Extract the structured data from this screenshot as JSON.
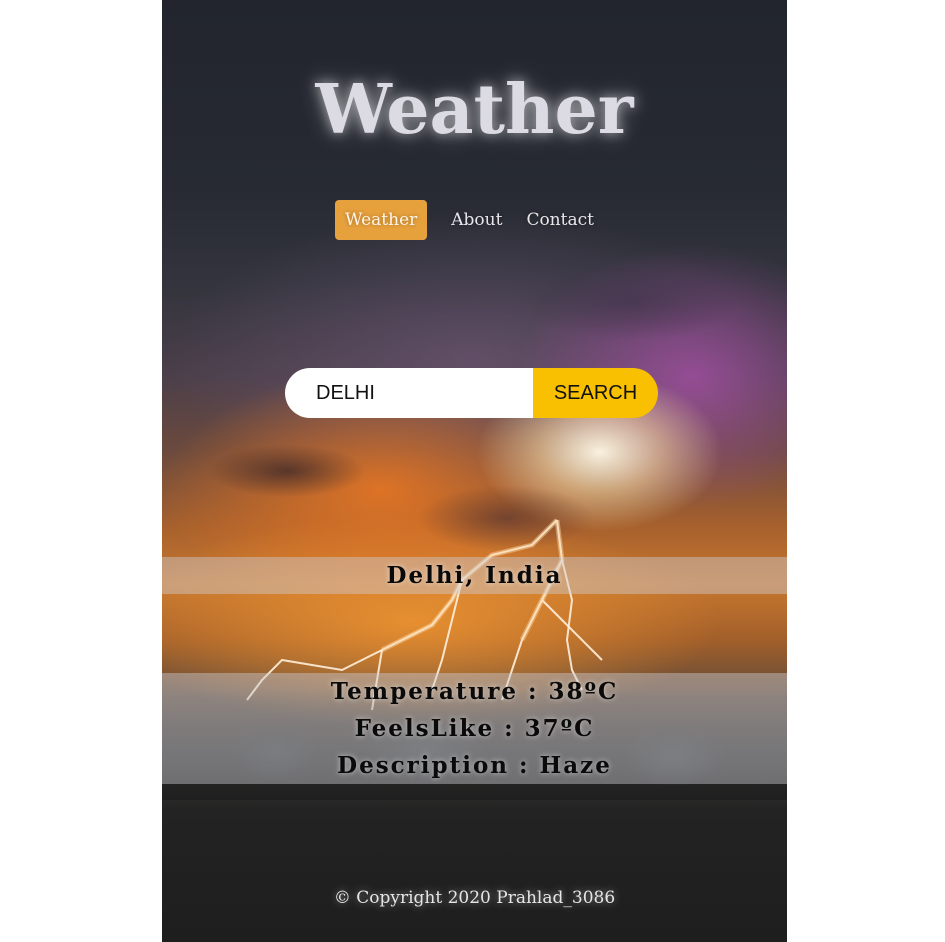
{
  "header": {
    "title": "Weather"
  },
  "nav": {
    "items": [
      {
        "label": "Weather",
        "active": true
      },
      {
        "label": "About",
        "active": false
      },
      {
        "label": "Contact",
        "active": false
      }
    ]
  },
  "search": {
    "value": "DELHI",
    "placeholder": "",
    "button_label": "SEARCH"
  },
  "result": {
    "city": "Delhi, India",
    "temperature": "Temperature : 38ºC",
    "feels_like": "FeelsLike : 37ºC",
    "description": "Description : Haze"
  },
  "footer": {
    "copyright": "© Copyright 2020 Prahlad_3086"
  },
  "colors": {
    "accent_nav": "#e6a03c",
    "search_button": "#f8c000",
    "title_text": "#dcdae3"
  }
}
